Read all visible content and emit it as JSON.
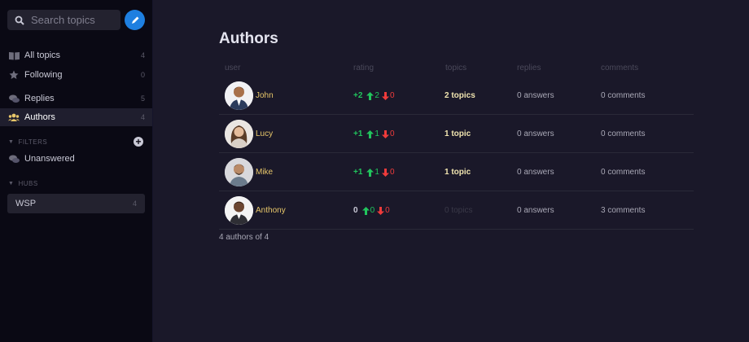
{
  "sidebar": {
    "search_placeholder": "Search topics",
    "nav": [
      {
        "label": "All topics",
        "count": "4",
        "icon": "book-icon"
      },
      {
        "label": "Following",
        "count": "0",
        "icon": "star-icon"
      },
      {
        "label": "Replies",
        "count": "5",
        "icon": "chat-icon"
      },
      {
        "label": "Authors",
        "count": "4",
        "icon": "users-icon"
      }
    ],
    "filters_label": "FILTERS",
    "filters": [
      {
        "label": "Unanswered",
        "icon": "chat-icon"
      }
    ],
    "hubs_label": "HUBS",
    "hubs": [
      {
        "label": "WSP",
        "count": "4"
      }
    ]
  },
  "main": {
    "title": "Authors",
    "columns": {
      "user": "user",
      "rating": "rating",
      "topics": "topics",
      "replies": "replies",
      "comments": "comments"
    },
    "authors": [
      {
        "name": "John",
        "score": "+2",
        "up": "2",
        "down": "0",
        "topics": "2 topics",
        "replies": "0 answers",
        "comments": "0 comments"
      },
      {
        "name": "Lucy",
        "score": "+1",
        "up": "1",
        "down": "0",
        "topics": "1 topic",
        "replies": "0 answers",
        "comments": "0 comments"
      },
      {
        "name": "Mike",
        "score": "+1",
        "up": "1",
        "down": "0",
        "topics": "1 topic",
        "replies": "0 answers",
        "comments": "0 comments"
      },
      {
        "name": "Anthony",
        "score": "0",
        "up": "0",
        "down": "0",
        "topics": "0 topics",
        "replies": "0 answers",
        "comments": "3 comments"
      }
    ],
    "footer": "4 authors of 4"
  },
  "colors": {
    "accent": "#1e7fe0",
    "name": "#e8c76a",
    "up": "#21c55d",
    "down": "#ef3b3b"
  }
}
